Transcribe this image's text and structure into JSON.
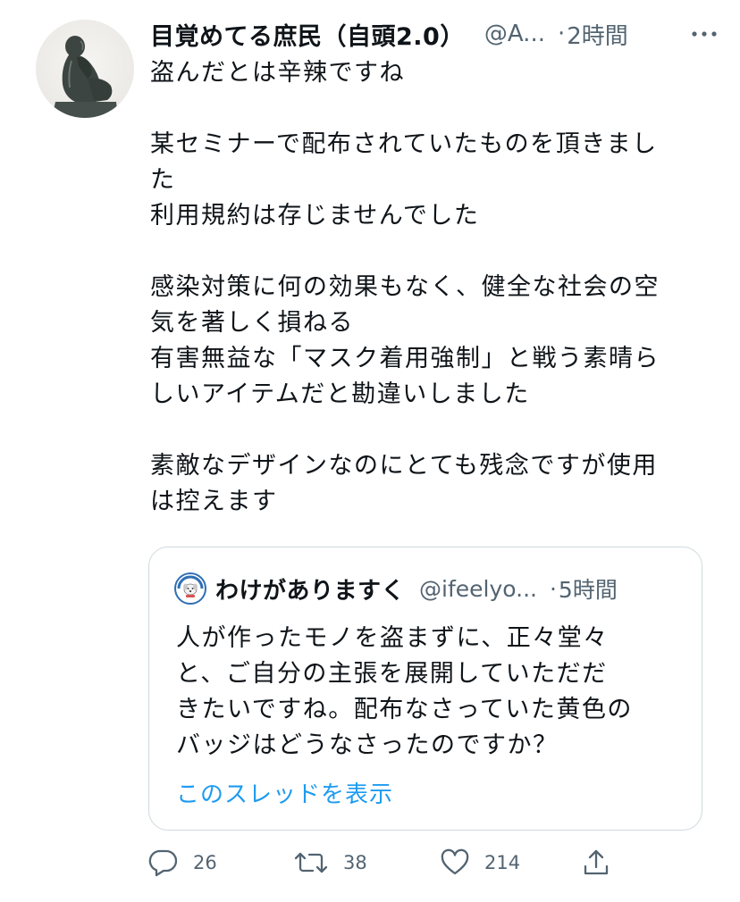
{
  "tweet": {
    "author": {
      "display_name": "目覚めてる庶民（自頭2.0）",
      "handle": "@A...",
      "avatar": "rodin-thinker-statue-avatar"
    },
    "separator": "·",
    "timestamp": "2時間",
    "more_icon": "more-horizontal-icon",
    "body_lines": [
      "盗んだとは辛辣ですね",
      "",
      "某セミナーで配布されていたものを頂きまし",
      "た",
      "利用規約は存じませんでした",
      "",
      "感染対策に何の効果もなく、健全な社会の空",
      "気を著しく損ねる",
      "有害無益な「マスク着用強制」と戦う素晴ら",
      "しいアイテムだと勘違いしました",
      "",
      "素敵なデザインなのにとても残念ですが使用",
      "は控えます"
    ]
  },
  "quoted_tweet": {
    "author": {
      "display_name": "わけがありますく",
      "handle": "@ifeelyo...",
      "avatar": "dog-badge-avatar"
    },
    "separator": "·",
    "timestamp": "5時間",
    "body_lines": [
      "人が作ったモノを盗まずに、正々堂々",
      "と、ご自分の主張を展開していただだ",
      "きたいですね。配布なさっていた黄色の",
      "バッジはどうなさったのですか？"
    ],
    "show_thread_label": "このスレッドを表示"
  },
  "actions": {
    "reply": {
      "icon": "reply-icon",
      "count": "26"
    },
    "retweet": {
      "icon": "retweet-icon",
      "count": "38"
    },
    "like": {
      "icon": "heart-icon",
      "count": "214"
    },
    "share": {
      "icon": "share-icon"
    }
  },
  "colors": {
    "text_primary": "#0f1419",
    "text_secondary": "#536471",
    "link": "#1d9bf0",
    "border": "#cfd9de"
  }
}
